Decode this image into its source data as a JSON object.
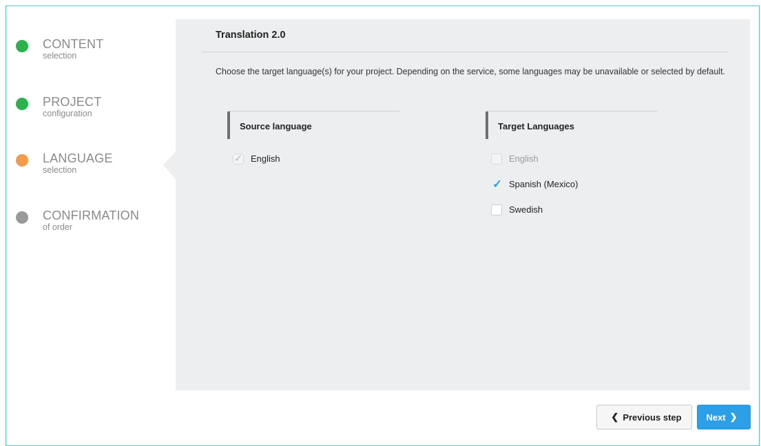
{
  "colors": {
    "done": "#2bb24c",
    "active": "#f39a4c",
    "pending": "#9a9a9a",
    "check_active": "#2d9fe6",
    "check_disabled": "#b8bcc0",
    "primary": "#2d9fe6"
  },
  "steps": [
    {
      "title": "CONTENT",
      "sub": "selection",
      "state": "done"
    },
    {
      "title": "PROJECT",
      "sub": "configuration",
      "state": "done"
    },
    {
      "title": "LANGUAGE",
      "sub": "selection",
      "state": "active"
    },
    {
      "title": "CONFIRMATION",
      "sub": "of order",
      "state": "pending"
    }
  ],
  "panel": {
    "title": "Translation 2.0",
    "description": "Choose the target language(s) for your project. Depending on the service, some languages may be unavailable or selected by default."
  },
  "source": {
    "heading": "Source language",
    "options": [
      {
        "label": "English",
        "checked": true,
        "disabled": true
      }
    ]
  },
  "target": {
    "heading": "Target Languages",
    "options": [
      {
        "label": "English",
        "checked": false,
        "disabled": true
      },
      {
        "label": "Spanish (Mexico)",
        "checked": true,
        "disabled": false
      },
      {
        "label": "Swedish",
        "checked": false,
        "disabled": false
      }
    ]
  },
  "footer": {
    "prev_label": "Previous step",
    "prev_icon": "chevron-left-icon",
    "next_label": "Next",
    "next_icon": "chevron-right-icon"
  }
}
